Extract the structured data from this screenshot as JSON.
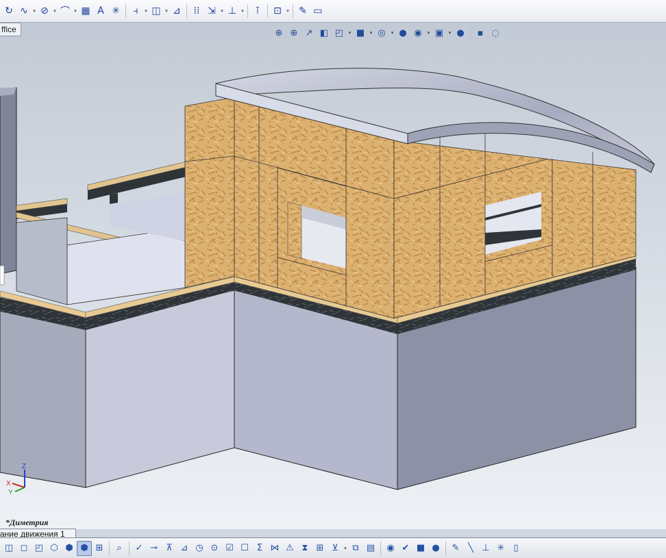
{
  "toolbar": {
    "tools": [
      {
        "icon": "arc-icon",
        "glyph": "↻"
      },
      {
        "icon": "spline-icon",
        "glyph": "∿"
      },
      {
        "icon": "ellipse-icon",
        "glyph": "⊘"
      },
      {
        "icon": "fillet-icon",
        "glyph": "⌒"
      },
      {
        "icon": "hatch-icon",
        "glyph": "▦"
      },
      {
        "icon": "text-icon",
        "glyph": "A"
      },
      {
        "icon": "point-icon",
        "glyph": "✳"
      },
      {
        "icon": "trim-icon",
        "glyph": "⫞"
      },
      {
        "icon": "offset-icon",
        "glyph": "◫"
      },
      {
        "icon": "mirror-icon",
        "glyph": "⊿"
      },
      {
        "icon": "pattern-icon",
        "glyph": "⁞⁞"
      },
      {
        "icon": "move-icon",
        "glyph": "⇲"
      },
      {
        "icon": "relation-icon",
        "glyph": "⊥"
      },
      {
        "icon": "repair-icon",
        "glyph": "⊺"
      },
      {
        "icon": "quick-snap-icon",
        "glyph": "⊡"
      },
      {
        "icon": "sketch-check-icon",
        "glyph": "✎"
      },
      {
        "icon": "picture-icon",
        "glyph": "▭"
      }
    ]
  },
  "office_tab": {
    "label": "ffice"
  },
  "heads_up": {
    "tools": [
      {
        "icon": "zoom-to-fit-icon",
        "glyph": "⊕"
      },
      {
        "icon": "zoom-area-icon",
        "glyph": "⊕"
      },
      {
        "icon": "previous-view-icon",
        "glyph": "↗"
      },
      {
        "icon": "section-view-icon",
        "glyph": "◧"
      },
      {
        "icon": "view-orientation-icon",
        "glyph": "◰"
      },
      {
        "icon": "display-style-icon",
        "glyph": "■"
      },
      {
        "icon": "hide-show-icon",
        "glyph": "◎"
      },
      {
        "icon": "appearance-icon",
        "glyph": "●"
      },
      {
        "icon": "scene-icon",
        "glyph": "◉"
      },
      {
        "icon": "view-settings-icon",
        "glyph": "▣"
      },
      {
        "icon": "render-icon",
        "glyph": "●"
      },
      {
        "icon": "shadow-icon",
        "glyph": "▪"
      },
      {
        "icon": "realview-icon",
        "glyph": "◌"
      }
    ]
  },
  "viewport": {
    "view_label": "*Диметрия",
    "triad": {
      "x": "X",
      "y": "Y",
      "z": "Z"
    }
  },
  "motion_tab": {
    "label": "ание движения 1"
  },
  "bottom_toolbar": {
    "tools": [
      {
        "icon": "view-cube-icon",
        "glyph": "◫"
      },
      {
        "icon": "wireframe-icon",
        "glyph": "◻"
      },
      {
        "icon": "hidden-lines-icon",
        "glyph": "◰"
      },
      {
        "icon": "hidden-removed-icon",
        "glyph": "⬡"
      },
      {
        "icon": "shaded-edges-icon",
        "glyph": "⬢"
      },
      {
        "icon": "shaded-icon",
        "glyph": "⬢",
        "active": true
      },
      {
        "icon": "perspective-icon",
        "glyph": "⊞"
      },
      {
        "icon": "brush-icon",
        "glyph": "⌕"
      },
      {
        "icon": "spell-check-icon",
        "glyph": "✓"
      },
      {
        "icon": "format-painter-icon",
        "glyph": "⊸"
      },
      {
        "icon": "balloon-icon",
        "glyph": "⊼"
      },
      {
        "icon": "note-icon",
        "glyph": "⊿"
      },
      {
        "icon": "surface-finish-icon",
        "glyph": "◷"
      },
      {
        "icon": "weld-icon",
        "glyph": "⊙"
      },
      {
        "icon": "checkbox-icon",
        "glyph": "☑"
      },
      {
        "icon": "checkbox-grey-icon",
        "glyph": "☐"
      },
      {
        "icon": "sum-icon",
        "glyph": "Σ"
      },
      {
        "icon": "dimension-icon",
        "glyph": "⋈"
      },
      {
        "icon": "warning-icon",
        "glyph": "⚠"
      },
      {
        "icon": "split-icon",
        "glyph": "⧗"
      },
      {
        "icon": "table-icon",
        "glyph": "⊞"
      },
      {
        "icon": "centerline-icon",
        "glyph": "⊻"
      },
      {
        "icon": "layer-icon",
        "glyph": "⧉"
      },
      {
        "icon": "palette-icon",
        "glyph": "▤"
      },
      {
        "icon": "eye-icon",
        "glyph": "◉"
      },
      {
        "icon": "tick-icon",
        "glyph": "✔"
      },
      {
        "icon": "color-icon",
        "glyph": "■"
      },
      {
        "icon": "appearance-ball-icon",
        "glyph": "●"
      },
      {
        "icon": "pencil-icon",
        "glyph": "✎"
      },
      {
        "icon": "line-icon",
        "glyph": "╲"
      },
      {
        "icon": "axis-icon",
        "glyph": "⊥"
      },
      {
        "icon": "snap-icon",
        "glyph": "✳"
      },
      {
        "icon": "cylinder-icon",
        "glyph": "▯"
      }
    ]
  }
}
